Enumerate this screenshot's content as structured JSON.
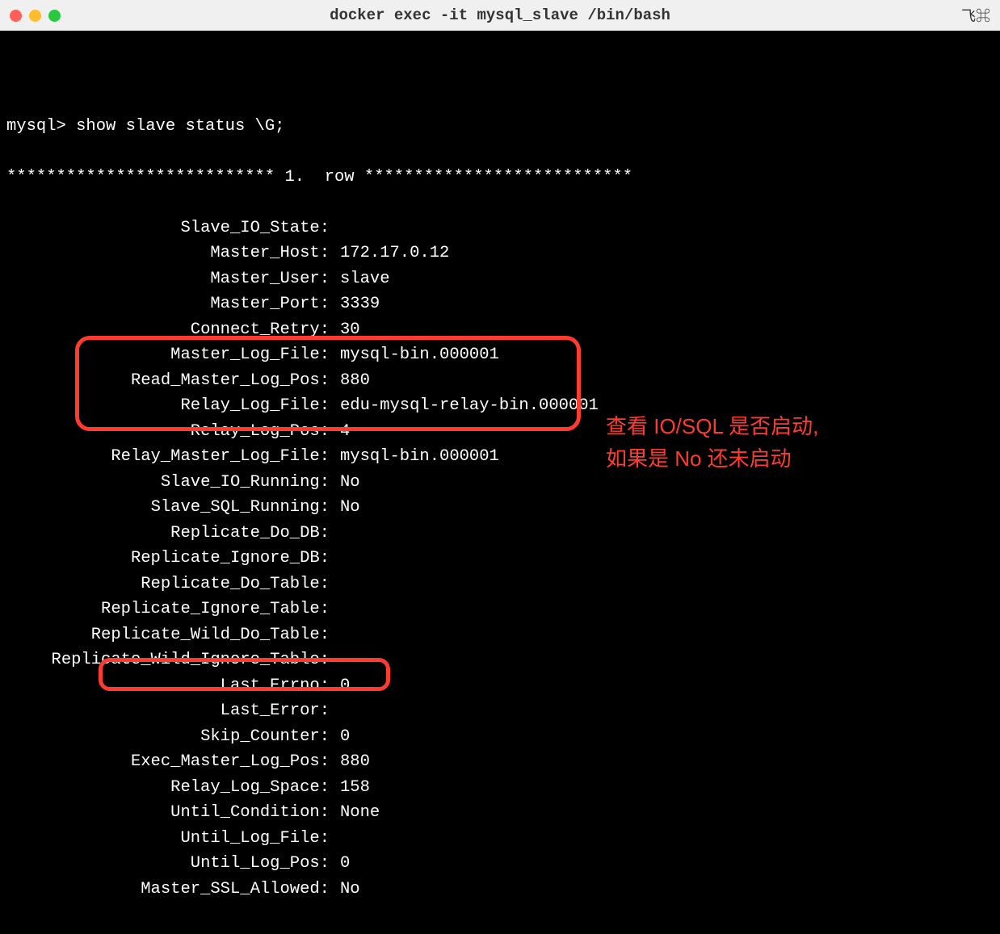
{
  "window": {
    "title": "docker exec -it mysql_slave /bin/bash",
    "right_symbols": "飞⌘"
  },
  "terminal": {
    "prompt": "mysql> ",
    "command": "show slave status \\G;",
    "row_header_prefix": "*************************** 1. ",
    "row_header_suffix": "row ***************************",
    "fields": [
      {
        "label": "Slave_IO_State",
        "value": ""
      },
      {
        "label": "Master_Host",
        "value": "172.17.0.12"
      },
      {
        "label": "Master_User",
        "value": "slave"
      },
      {
        "label": "Master_Port",
        "value": "3339"
      },
      {
        "label": "Connect_Retry",
        "value": "30"
      },
      {
        "label": "Master_Log_File",
        "value": "mysql-bin.000001"
      },
      {
        "label": "Read_Master_Log_Pos",
        "value": "880"
      },
      {
        "label": "Relay_Log_File",
        "value": "edu-mysql-relay-bin.000001"
      },
      {
        "label": "Relay_Log_Pos",
        "value": "4"
      },
      {
        "label": "Relay_Master_Log_File",
        "value": "mysql-bin.000001"
      },
      {
        "label": "Slave_IO_Running",
        "value": "No"
      },
      {
        "label": "Slave_SQL_Running",
        "value": "No"
      },
      {
        "label": "Replicate_Do_DB",
        "value": ""
      },
      {
        "label": "Replicate_Ignore_DB",
        "value": ""
      },
      {
        "label": "Replicate_Do_Table",
        "value": ""
      },
      {
        "label": "Replicate_Ignore_Table",
        "value": ""
      },
      {
        "label": "Replicate_Wild_Do_Table",
        "value": ""
      },
      {
        "label": "Replicate_Wild_Ignore_Table",
        "value": ""
      },
      {
        "label": "Last_Errno",
        "value": "0"
      },
      {
        "label": "Last_Error",
        "value": ""
      },
      {
        "label": "Skip_Counter",
        "value": "0"
      },
      {
        "label": "Exec_Master_Log_Pos",
        "value": "880"
      },
      {
        "label": "Relay_Log_Space",
        "value": "158"
      },
      {
        "label": "Until_Condition",
        "value": "None"
      },
      {
        "label": "Until_Log_File",
        "value": ""
      },
      {
        "label": "Until_Log_Pos",
        "value": "0"
      },
      {
        "label": "Master_SSL_Allowed",
        "value": "No"
      }
    ]
  },
  "annotations": {
    "text1_line1": "查看 IO/SQL 是否启动,",
    "text1_line2": "如果是 No 还未启动"
  }
}
